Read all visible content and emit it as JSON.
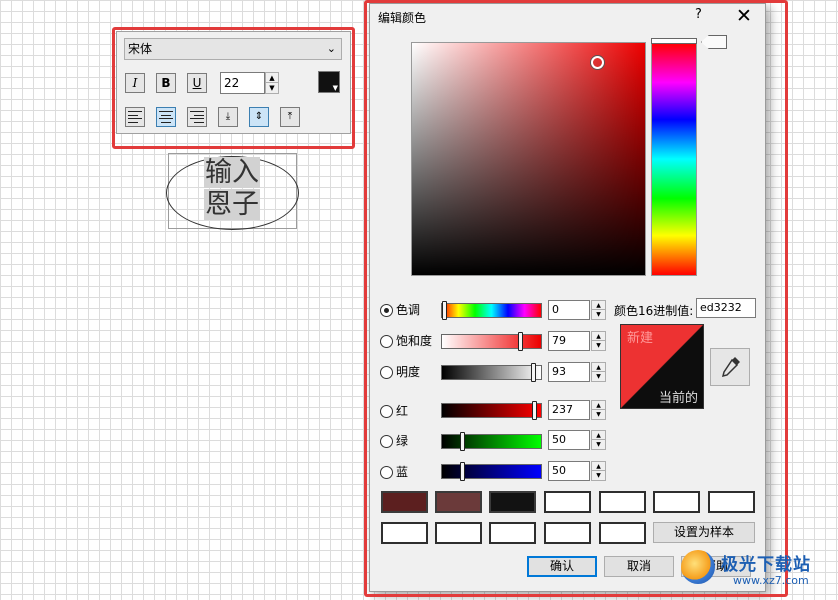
{
  "toolbar": {
    "font_name": "宋体",
    "italic_label": "I",
    "bold_label": "B",
    "underline_label": "U",
    "font_size": "22",
    "text_color": "#111111",
    "align_buttons": [
      "align-left",
      "align-center",
      "align-right",
      "valign-bottom",
      "valign-middle",
      "valign-top"
    ]
  },
  "canvas_text": {
    "line1": "输入",
    "line2": "恩子"
  },
  "dialog": {
    "title": "编辑颜色",
    "help_glyph": "?",
    "close_glyph": "✕",
    "selected_hue_color": "#ed0000",
    "rows": [
      {
        "label": "色调",
        "value": "0",
        "selected": true
      },
      {
        "label": "饱和度",
        "value": "79",
        "selected": false
      },
      {
        "label": "明度",
        "value": "93",
        "selected": false
      },
      {
        "label": "红",
        "value": "237",
        "selected": false
      },
      {
        "label": "绿",
        "value": "50",
        "selected": false
      },
      {
        "label": "蓝",
        "value": "50",
        "selected": false
      }
    ],
    "hex_label": "颜色16进制值:",
    "hex_value": "ed3232",
    "preview": {
      "new_label": "新建",
      "current_label": "当前的",
      "new_color": "#ed3232",
      "current_color": "#0d0d0d"
    },
    "swatches_row1": [
      "#5c1f1f",
      "#6b3a3a",
      "#121212",
      "",
      "",
      "",
      ""
    ],
    "swatches_row2": [
      "",
      "",
      "",
      "",
      ""
    ],
    "set_sample_button": "设置为样本",
    "ok_button": "确认",
    "cancel_button": "取消",
    "help_button": "帮助"
  },
  "watermark": {
    "title": "极光下载站",
    "url": "www.xz7.com"
  },
  "colors": {
    "annotation_red": "#e23b3b",
    "default_button_border": "#0078d7"
  }
}
